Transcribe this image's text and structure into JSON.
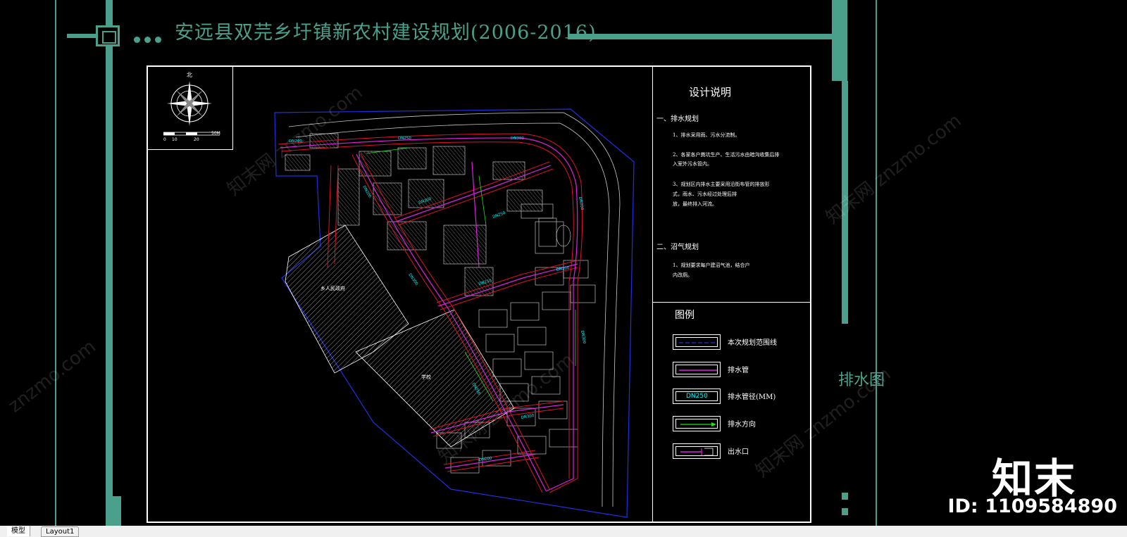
{
  "drawing": {
    "title": "安远县双芫乡圩镇新农村建设规划(2006-2016)",
    "sheet_name": "排水图"
  },
  "design_notes": {
    "heading": "设计说明",
    "section1_title": "一、排水规划",
    "section1_items": [
      "1、排水采用雨、污水分流制。",
      "2、各家各户粪坑生产、生活污水由暗沟收集后排",
      "入室外污水管内。",
      "3、规划区内排水主要采用沿街布管的排放形",
      "式，雨水、污水经过处理后排",
      "放，最终排入河流。"
    ],
    "section2_title": "二、沼气规划",
    "section2_items": [
      "1、规划要求每户建沼气池，结合户",
      "内改厕。"
    ]
  },
  "legend": {
    "heading": "图例",
    "items": [
      {
        "label": "本次规划范围线",
        "sample": "dash-blue"
      },
      {
        "label": "排水管",
        "sample": "magenta"
      },
      {
        "label": "排水管径(MM)",
        "sample": "DN250"
      },
      {
        "label": "排水方向",
        "sample": "green-arrow"
      },
      {
        "label": "出水口",
        "sample": "magenta-outlet"
      }
    ]
  },
  "map_labels": {
    "compass_north": "北",
    "scale_ticks": [
      "0",
      "10",
      "20",
      "50M"
    ],
    "area_a": "乡人民政府",
    "area_b": "学校",
    "pipe_labels": [
      "DN200",
      "DN250",
      "DN300",
      "DN200",
      "DN300",
      "DN250",
      "DN200",
      "DN300",
      "DN250",
      "DN200",
      "DN300",
      "DN250",
      "DN300",
      "DN200"
    ]
  },
  "tabs": [
    "模型",
    "Layout1"
  ],
  "watermark": {
    "logo": "知末",
    "id": "ID: 1109584890",
    "site": "znzmo.com",
    "site_cn": "知末网"
  },
  "colors": {
    "accent": "#4aa08a",
    "road": "#e0102a",
    "pipe": "#e020e0",
    "boundary": "#2030e0",
    "label": "#00ffff",
    "arrow": "#20e020"
  }
}
